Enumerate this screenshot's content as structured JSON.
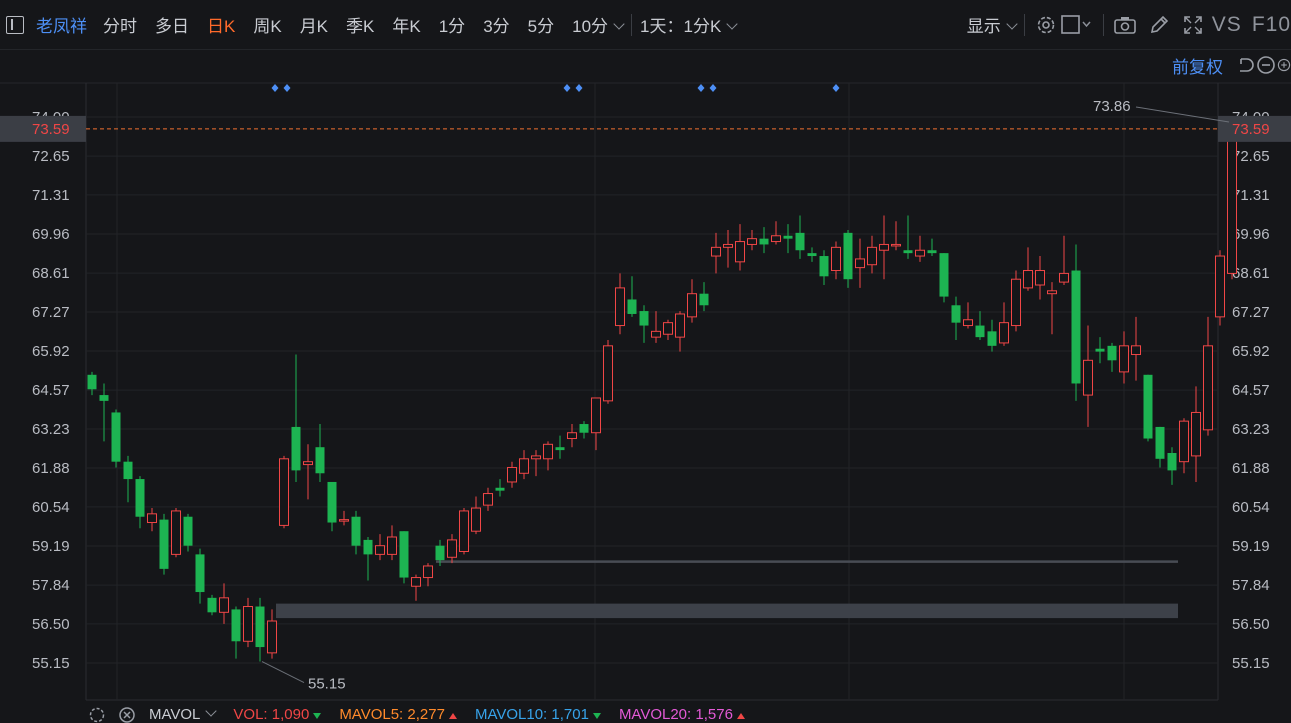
{
  "toolbar": {
    "stock_name": "老凤祥",
    "periods": [
      {
        "label": "分时",
        "active": false
      },
      {
        "label": "多日",
        "active": false
      },
      {
        "label": "日K",
        "active": true
      },
      {
        "label": "周K",
        "active": false
      },
      {
        "label": "月K",
        "active": false
      },
      {
        "label": "季K",
        "active": false
      },
      {
        "label": "年K",
        "active": false
      },
      {
        "label": "1分",
        "active": false
      },
      {
        "label": "3分",
        "active": false
      },
      {
        "label": "5分",
        "active": false
      }
    ],
    "more_period": "10分",
    "multi_period": "1天：1分K",
    "display_label": "显示",
    "vs_label": "VS",
    "f10_label": "F10"
  },
  "subbar": {
    "adjust_label": "前复权"
  },
  "colors": {
    "up": "#f04646",
    "down": "#1db452",
    "accent": "#4d8ff5",
    "active_tab": "#ff6a2b",
    "price_line": "#f07030",
    "bg": "#151619"
  },
  "chart_data": {
    "type": "candlestick",
    "y_ticks": [
      "74.00",
      "72.65",
      "71.31",
      "69.96",
      "68.61",
      "67.27",
      "65.92",
      "64.57",
      "63.23",
      "61.88",
      "60.54",
      "59.19",
      "57.84",
      "56.50",
      "55.15"
    ],
    "current_price": "73.59",
    "max_label": "73.86",
    "min_label": "55.15",
    "candles": [
      [
        65.1,
        64.6,
        65.2,
        64.4
      ],
      [
        64.4,
        64.2,
        64.8,
        62.8
      ],
      [
        63.8,
        62.1,
        63.9,
        61.9
      ],
      [
        62.1,
        61.5,
        62.3,
        60.7
      ],
      [
        61.5,
        60.2,
        61.6,
        59.8
      ],
      [
        60.0,
        60.3,
        60.5,
        59.7
      ],
      [
        60.1,
        58.4,
        60.3,
        58.2
      ],
      [
        58.9,
        60.4,
        60.5,
        58.8
      ],
      [
        60.2,
        59.2,
        60.3,
        59.0
      ],
      [
        58.9,
        57.6,
        59.1,
        57.2
      ],
      [
        57.4,
        56.9,
        57.5,
        56.8
      ],
      [
        56.9,
        57.4,
        57.9,
        56.5
      ],
      [
        57.0,
        55.9,
        57.1,
        55.3
      ],
      [
        55.9,
        57.1,
        57.4,
        55.7
      ],
      [
        57.1,
        55.7,
        57.4,
        55.2
      ],
      [
        55.5,
        56.6,
        57.0,
        55.3
      ],
      [
        59.9,
        62.2,
        62.3,
        59.8
      ],
      [
        63.3,
        61.8,
        65.8,
        61.4
      ],
      [
        62.0,
        62.1,
        62.7,
        60.8
      ],
      [
        62.6,
        61.7,
        63.4,
        61.4
      ],
      [
        61.4,
        60.0,
        61.4,
        59.7
      ],
      [
        60.1,
        60.1,
        60.4,
        59.9
      ],
      [
        60.2,
        59.2,
        60.4,
        58.9
      ],
      [
        59.4,
        58.9,
        59.5,
        58.0
      ],
      [
        58.9,
        59.2,
        59.6,
        58.7
      ],
      [
        58.9,
        59.5,
        59.9,
        58.7
      ],
      [
        59.7,
        58.1,
        59.7,
        57.9
      ],
      [
        57.8,
        58.1,
        58.2,
        57.3
      ],
      [
        58.1,
        58.5,
        58.6,
        57.8
      ],
      [
        59.2,
        58.7,
        59.4,
        58.5
      ],
      [
        58.8,
        59.4,
        59.6,
        58.6
      ],
      [
        59.0,
        60.4,
        60.5,
        58.9
      ],
      [
        59.7,
        60.5,
        60.9,
        59.6
      ],
      [
        60.6,
        61.0,
        61.2,
        60.4
      ],
      [
        61.2,
        61.1,
        61.5,
        60.9
      ],
      [
        61.4,
        61.9,
        62.1,
        61.2
      ],
      [
        61.7,
        62.2,
        62.5,
        61.5
      ],
      [
        62.2,
        62.3,
        62.5,
        61.6
      ],
      [
        62.2,
        62.7,
        62.8,
        61.8
      ],
      [
        62.6,
        62.5,
        63.0,
        62.2
      ],
      [
        62.9,
        63.1,
        63.4,
        62.6
      ],
      [
        63.4,
        63.1,
        63.5,
        62.9
      ],
      [
        63.1,
        64.3,
        64.3,
        62.5
      ],
      [
        64.2,
        66.1,
        66.3,
        64.1
      ],
      [
        66.8,
        68.1,
        68.6,
        66.5
      ],
      [
        67.7,
        67.2,
        68.5,
        67.1
      ],
      [
        67.3,
        66.8,
        67.5,
        66.2
      ],
      [
        66.4,
        66.6,
        67.3,
        66.2
      ],
      [
        66.5,
        66.9,
        67.0,
        66.3
      ],
      [
        66.4,
        67.2,
        67.3,
        65.9
      ],
      [
        67.1,
        67.9,
        68.4,
        66.9
      ],
      [
        67.9,
        67.5,
        68.3,
        67.3
      ],
      [
        69.2,
        69.5,
        70.0,
        68.6
      ],
      [
        69.5,
        69.6,
        70.1,
        68.8
      ],
      [
        69.0,
        69.7,
        70.3,
        68.7
      ],
      [
        69.6,
        69.8,
        70.1,
        69.4
      ],
      [
        69.8,
        69.6,
        70.2,
        69.3
      ],
      [
        69.7,
        69.9,
        70.4,
        69.6
      ],
      [
        69.9,
        69.8,
        70.3,
        69.3
      ],
      [
        70.0,
        69.4,
        70.6,
        69.1
      ],
      [
        69.3,
        69.2,
        69.5,
        69.0
      ],
      [
        69.2,
        68.5,
        69.4,
        68.2
      ],
      [
        68.7,
        69.5,
        69.7,
        68.4
      ],
      [
        70.0,
        68.4,
        70.1,
        68.1
      ],
      [
        68.8,
        69.1,
        69.8,
        68.1
      ],
      [
        68.9,
        69.5,
        69.9,
        68.6
      ],
      [
        69.4,
        69.6,
        70.6,
        68.4
      ],
      [
        69.6,
        69.6,
        70.4,
        69.4
      ],
      [
        69.4,
        69.3,
        70.6,
        69.1
      ],
      [
        69.2,
        69.4,
        69.9,
        69.0
      ],
      [
        69.4,
        69.3,
        69.8,
        69.2
      ],
      [
        69.3,
        67.8,
        69.3,
        67.6
      ],
      [
        67.5,
        66.9,
        67.8,
        66.3
      ],
      [
        66.8,
        67.0,
        67.6,
        66.7
      ],
      [
        66.8,
        66.4,
        67.3,
        66.3
      ],
      [
        66.6,
        66.1,
        67.0,
        65.9
      ],
      [
        66.2,
        66.9,
        67.6,
        66.1
      ],
      [
        66.8,
        68.4,
        68.7,
        66.6
      ],
      [
        68.1,
        68.7,
        69.5,
        68.0
      ],
      [
        68.2,
        68.7,
        69.2,
        67.7
      ],
      [
        67.9,
        68.0,
        68.3,
        66.5
      ],
      [
        68.3,
        68.6,
        69.9,
        68.2
      ],
      [
        68.7,
        64.8,
        69.6,
        64.2
      ],
      [
        64.4,
        65.6,
        66.8,
        63.3
      ],
      [
        66.0,
        65.9,
        66.4,
        65.5
      ],
      [
        66.1,
        65.6,
        66.2,
        65.2
      ],
      [
        65.2,
        66.1,
        66.6,
        64.8
      ],
      [
        65.8,
        66.1,
        67.1,
        64.9
      ],
      [
        65.1,
        62.9,
        65.1,
        62.8
      ],
      [
        63.3,
        62.2,
        63.3,
        61.9
      ],
      [
        62.4,
        61.8,
        62.6,
        61.3
      ],
      [
        62.1,
        63.5,
        63.6,
        61.7
      ],
      [
        62.3,
        63.8,
        64.7,
        61.4
      ],
      [
        63.2,
        66.1,
        67.1,
        63.0
      ],
      [
        67.1,
        69.2,
        69.4,
        66.8
      ],
      [
        68.6,
        73.59,
        73.86,
        68.4
      ]
    ],
    "support_zone": {
      "low": 56.7,
      "high": 57.2
    },
    "support_line": 58.65,
    "signal_diamond_indices": [
      7,
      8,
      18,
      19,
      24,
      25,
      30
    ],
    "indicator_tabs": [
      {
        "label": "MAVOL",
        "value": "",
        "color": "#c9ccd2"
      },
      {
        "label": "VOL:",
        "value": "1,090",
        "color": "#f04646",
        "trend": "down"
      },
      {
        "label": "MAVOL5:",
        "value": "2,277",
        "color": "#ff8a2b",
        "trend": "up"
      },
      {
        "label": "MAVOL10:",
        "value": "1,701",
        "color": "#37a3ea",
        "trend": "down"
      },
      {
        "label": "MAVOL20:",
        "value": "1,576",
        "color": "#e35ad6",
        "trend": "up"
      }
    ]
  }
}
